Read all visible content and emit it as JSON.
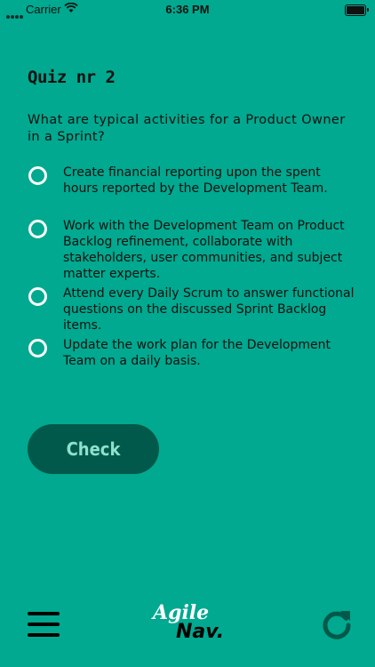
{
  "status_bar": {
    "carrier": "Carrier",
    "time": "6:36 PM"
  },
  "quiz": {
    "title": "Quiz nr 2",
    "question": "What are typical activities for a Product Owner in a Sprint?",
    "options": [
      "Create financial reporting upon the spent hours reported by the Development Team.",
      "Work with the Development Team on Product Backlog refinement, collaborate with stakeholders, user communities, and subject matter experts.",
      "Attend every Daily Scrum to answer functional questions on the discussed Sprint Backlog items.",
      "Update the work plan for the Development Team on a daily basis."
    ],
    "check_label": "Check"
  },
  "logo": {
    "line1": "Agile",
    "line2": "Nav."
  },
  "colors": {
    "background": "#00A98F",
    "button": "#00594A",
    "button_text": "#8FE0CC"
  },
  "icons": {
    "menu": "hamburger-icon",
    "refresh": "refresh-icon"
  }
}
